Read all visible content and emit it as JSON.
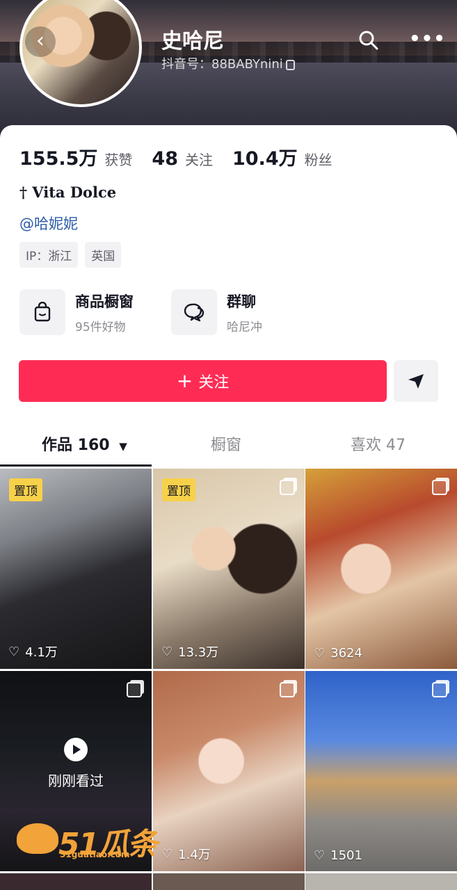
{
  "header": {
    "name": "史哈尼",
    "douyin_id": "抖音号：88BABYnini"
  },
  "stats": {
    "likes_num": "155.5万",
    "likes_label": "获赞",
    "following_num": "48",
    "following_label": "关注",
    "followers_num": "10.4万",
    "followers_label": "粉丝"
  },
  "bio": "† Vita Dolce",
  "mention": "@哈妮妮",
  "tags": [
    "IP：浙江",
    "英国"
  ],
  "entries": [
    {
      "title": "商品橱窗",
      "sub": "95件好物",
      "icon": "shopping-bag-icon"
    },
    {
      "title": "群聊",
      "sub": "哈尼冲",
      "icon": "chat-bubbles-icon"
    }
  ],
  "follow_button": "关注",
  "tabs": [
    {
      "label": "作品 160",
      "active": true
    },
    {
      "label": "橱窗",
      "active": false
    },
    {
      "label": "喜欢 47",
      "active": false
    }
  ],
  "grid": [
    {
      "pinned": "置顶",
      "multi": false,
      "likes": "4.1万"
    },
    {
      "pinned": "置顶",
      "multi": true,
      "likes": "13.3万"
    },
    {
      "pinned": "",
      "multi": true,
      "likes": "3624"
    },
    {
      "pinned": "",
      "multi": true,
      "likes": "",
      "watched": "刚刚看过"
    },
    {
      "pinned": "",
      "multi": true,
      "likes": "1.4万"
    },
    {
      "pinned": "",
      "multi": true,
      "likes": "1501"
    }
  ],
  "watermark": {
    "brand": "51瓜条",
    "url": "51guatiao.com"
  },
  "colors": {
    "follow": "#fe2c55",
    "pin": "#f7d14a",
    "link": "#2b5ca8"
  }
}
